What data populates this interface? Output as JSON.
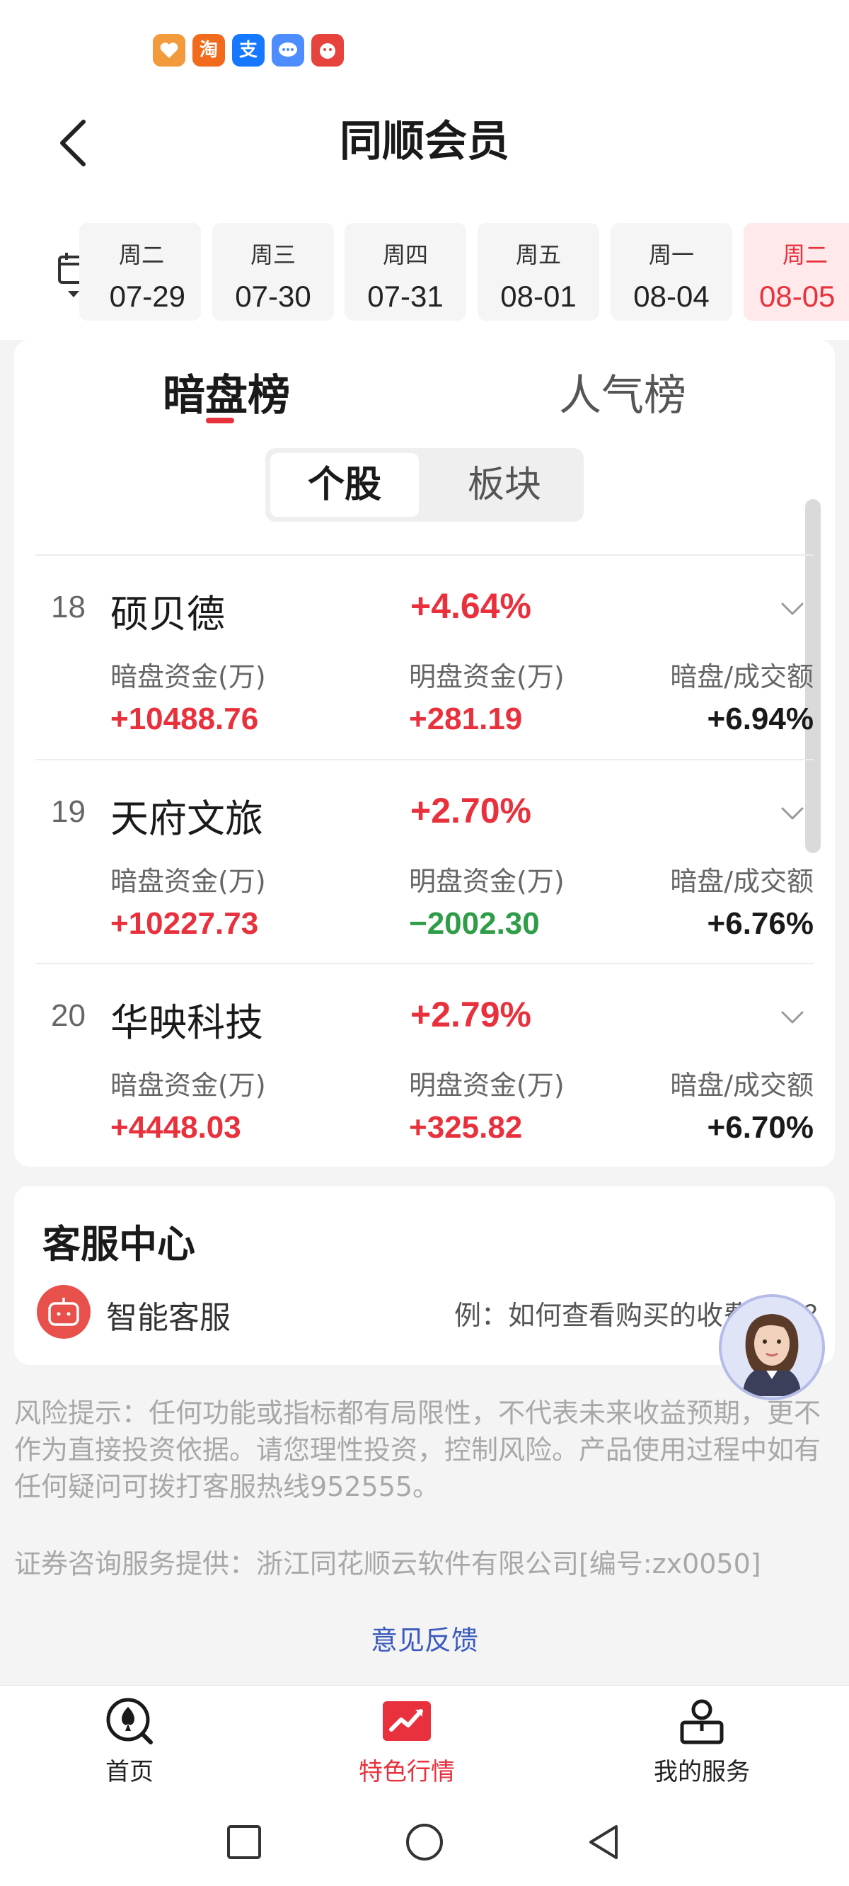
{
  "status_bar": {
    "apps": [
      {
        "icon": "heart-app-icon",
        "color": "#f39a3c"
      },
      {
        "icon": "taobao-app-icon",
        "glyph": "淘",
        "color": "#f26a1b"
      },
      {
        "icon": "alipay-app-icon",
        "glyph": "支",
        "color": "#1677ff"
      },
      {
        "icon": "message-app-icon",
        "color": "#4d8dff"
      },
      {
        "icon": "game-app-icon",
        "color": "#e6433c"
      }
    ]
  },
  "header": {
    "title": "同顺会员",
    "back_icon": "back-arrow-icon"
  },
  "date_strip": {
    "calendar_icon": "calendar-icon",
    "days": [
      {
        "weekday": "周二",
        "date": "07-29",
        "active": false
      },
      {
        "weekday": "周三",
        "date": "07-30",
        "active": false
      },
      {
        "weekday": "周四",
        "date": "07-31",
        "active": false
      },
      {
        "weekday": "周五",
        "date": "08-01",
        "active": false
      },
      {
        "weekday": "周一",
        "date": "08-04",
        "active": false
      },
      {
        "weekday": "周二",
        "date": "08-05",
        "active": true
      }
    ]
  },
  "tabs": [
    {
      "label": "暗盘榜",
      "active": true
    },
    {
      "label": "人气榜",
      "active": false
    }
  ],
  "segments": [
    {
      "label": "个股",
      "active": true
    },
    {
      "label": "板块",
      "active": false
    }
  ],
  "stocks": [
    {
      "rank": "18",
      "name": "硕贝德",
      "change": "+4.64%",
      "dark_label": "暗盘资金(万)",
      "dark_value": "+10488.76",
      "open_label": "明盘资金(万)",
      "open_value": "+281.19",
      "open_trend": "up",
      "ratio_label": "暗盘/成交额",
      "ratio_value": "+6.94%"
    },
    {
      "rank": "19",
      "name": "天府文旅",
      "change": "+2.70%",
      "dark_label": "暗盘资金(万)",
      "dark_value": "+10227.73",
      "open_label": "明盘资金(万)",
      "open_value": "−2002.30",
      "open_trend": "down",
      "ratio_label": "暗盘/成交额",
      "ratio_value": "+6.76%"
    },
    {
      "rank": "20",
      "name": "华映科技",
      "change": "+2.79%",
      "dark_label": "暗盘资金(万)",
      "dark_value": "+4448.03",
      "open_label": "明盘资金(万)",
      "open_value": "+325.82",
      "open_trend": "up",
      "ratio_label": "暗盘/成交额",
      "ratio_value": "+6.70%"
    }
  ],
  "service": {
    "title": "客服中心",
    "ai_label": "智能客服",
    "example": "例：如何查看购买的收费产品？"
  },
  "disclaimer": {
    "risk": "风险提示：任何功能或指标都有局限性，不代表未来收益预期，更不作为直接投资依据。请您理性投资，控制风险。产品使用过程中如有任何疑问可拨打客服热线952555。",
    "provider": "证券咨询服务提供：浙江同花顺云软件有限公司[编号:zx0050]",
    "feedback": "意见反馈"
  },
  "bottom_nav": [
    {
      "label": "首页",
      "icon": "home-icon",
      "active": false
    },
    {
      "label": "特色行情",
      "icon": "market-chart-icon",
      "active": true
    },
    {
      "label": "我的服务",
      "icon": "my-service-icon",
      "active": false
    }
  ],
  "colors": {
    "accent": "#e8313c",
    "down": "#2f9d48",
    "link": "#3b5bbd"
  }
}
